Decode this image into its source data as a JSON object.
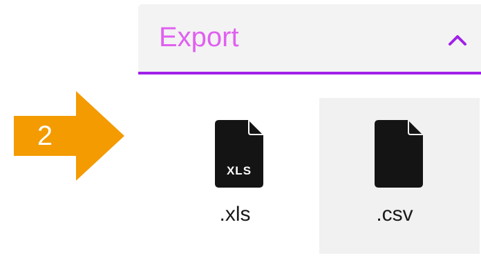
{
  "callout": {
    "step_number": "2",
    "color": "#f39b00"
  },
  "export_panel": {
    "title": "Export",
    "title_color": "#e060f0",
    "accent_color": "#a020e8",
    "toggle_icon": "chevron-up-icon",
    "state": "expanded"
  },
  "options": [
    {
      "label": ".xls",
      "icon": "xls-file-icon",
      "icon_tag": "XLS",
      "selected": false
    },
    {
      "label": ".csv",
      "icon": "file-icon",
      "selected": false,
      "hovered": true
    }
  ]
}
